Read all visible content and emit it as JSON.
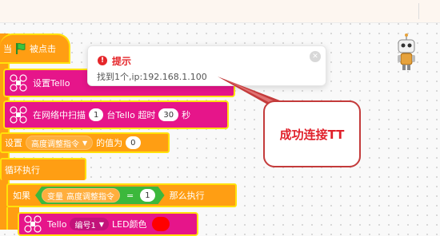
{
  "toast": {
    "title": "提示",
    "message": "找到1个,ip:192.168.1.100",
    "close_icon": "close-icon",
    "alert_icon": "error-icon"
  },
  "callout": {
    "text": "成功连接TT"
  },
  "blocks": {
    "when_flag": {
      "prefix": "当",
      "suffix": "被点击"
    },
    "setup_tello": {
      "label": "设置Tello",
      "hidden_tail": "…"
    },
    "scan": {
      "prefix": "在网络中扫描",
      "count": "1",
      "middle": "台Tello 超时",
      "timeout": "30",
      "unit": "秒"
    },
    "set_var": {
      "prefix": "设置",
      "variable": "高度调整指令",
      "suffix": "的值为",
      "value": "0"
    },
    "loop": {
      "label": "循环执行"
    },
    "if_block": {
      "prefix": "如果",
      "var_word": "变量",
      "var_name": "高度调整指令",
      "op": "=",
      "value": "1",
      "suffix": "那么执行"
    },
    "led": {
      "prefix": "Tello",
      "target": "编号1",
      "suffix": "LED颜色"
    }
  },
  "colors": {
    "block_pink": "#e6158a",
    "block_orange": "#ff9e13",
    "highlight_yellow": "#ffe10a",
    "alert_red": "#e5262a",
    "green_if": "#3cb83c"
  }
}
